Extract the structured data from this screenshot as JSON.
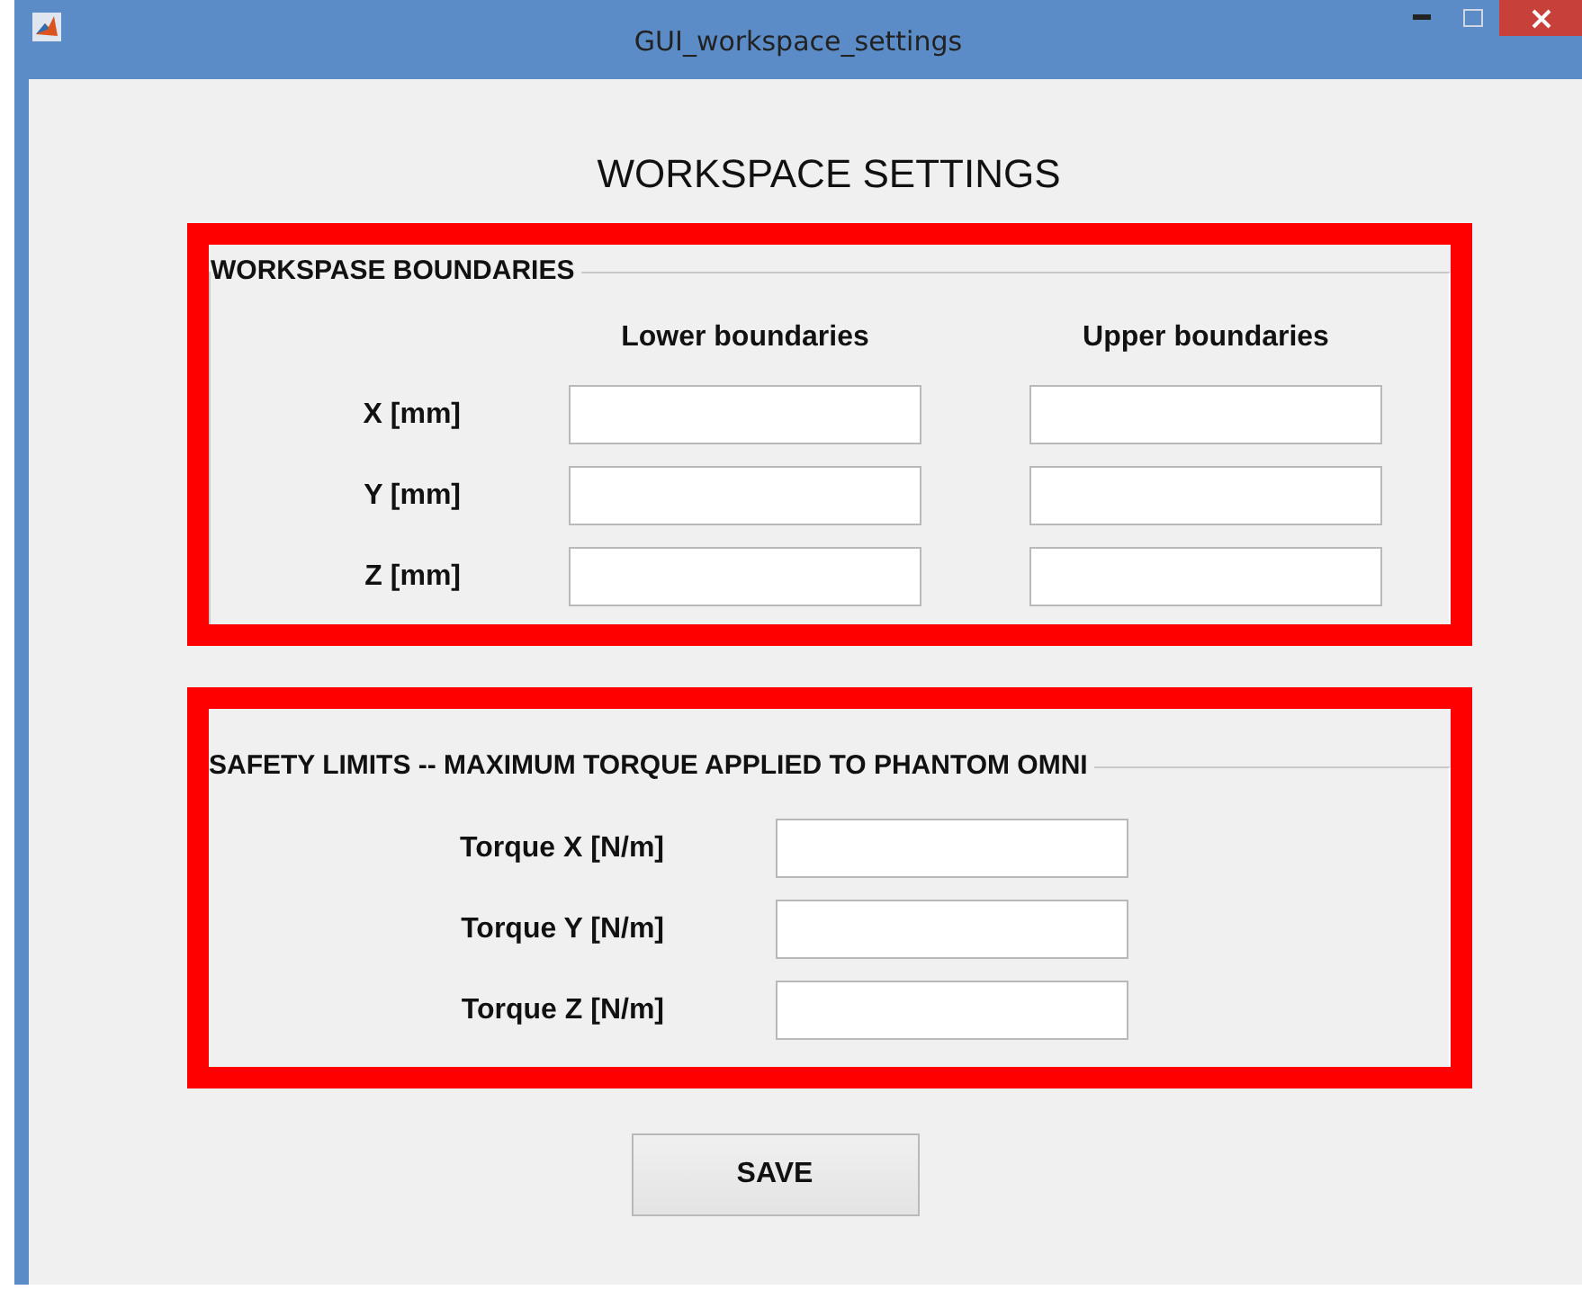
{
  "window": {
    "title": "GUI_workspace_settings"
  },
  "heading": "WORKSPACE SETTINGS",
  "boundaries": {
    "title": "WORKSPASE BOUNDARIES",
    "columns": [
      "Lower boundaries",
      "Upper boundaries"
    ],
    "rows": [
      {
        "label": "X [mm]"
      },
      {
        "label": "Y [mm]"
      },
      {
        "label": "Z [mm]"
      }
    ]
  },
  "safety": {
    "title": "SAFETY LIMITS -- MAXIMUM TORQUE APPLIED TO PHANTOM OMNI",
    "rows": [
      {
        "label": "Torque X [N/m]"
      },
      {
        "label": "Torque Y [N/m]"
      },
      {
        "label": "Torque Z [N/m]"
      }
    ]
  },
  "buttons": [
    "SAVE"
  ]
}
